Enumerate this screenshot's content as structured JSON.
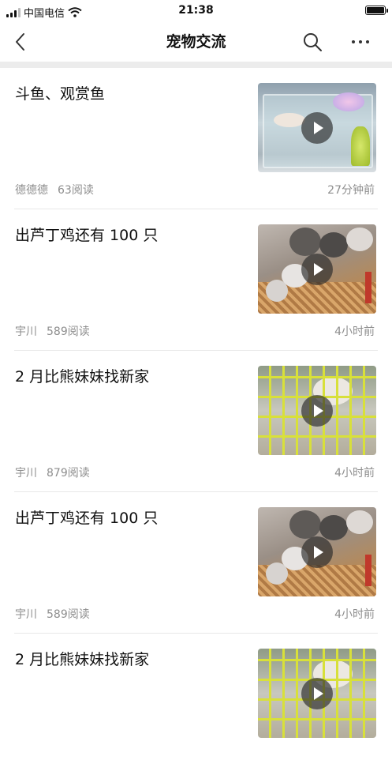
{
  "status_bar": {
    "carrier": "中国电信",
    "time": "21:38"
  },
  "nav": {
    "title": "宠物交流"
  },
  "feed": [
    {
      "title": "斗鱼、观赏鱼",
      "author": "德德德",
      "reads": "63阅读",
      "time": "27分钟前",
      "thumb": "fish-tank"
    },
    {
      "title": "出芦丁鸡还有 100 只",
      "author": "宇川",
      "reads": "589阅读",
      "time": "4小时前",
      "thumb": "chicks"
    },
    {
      "title": "2 月比熊妹妹找新家",
      "author": "宇川",
      "reads": "879阅读",
      "time": "4小时前",
      "thumb": "ferret-cage"
    },
    {
      "title": "出芦丁鸡还有 100 只",
      "author": "宇川",
      "reads": "589阅读",
      "time": "4小时前",
      "thumb": "chicks"
    },
    {
      "title": "2 月比熊妹妹找新家",
      "author": "",
      "reads": "",
      "time": "",
      "thumb": "ferret-cage"
    }
  ],
  "icons": {
    "back": "chevron-left-icon",
    "search": "search-icon",
    "more": "more-horizontal-icon",
    "play": "play-icon"
  },
  "colors": {
    "meta_text": "#8e8e8e",
    "divider": "#ececec"
  }
}
